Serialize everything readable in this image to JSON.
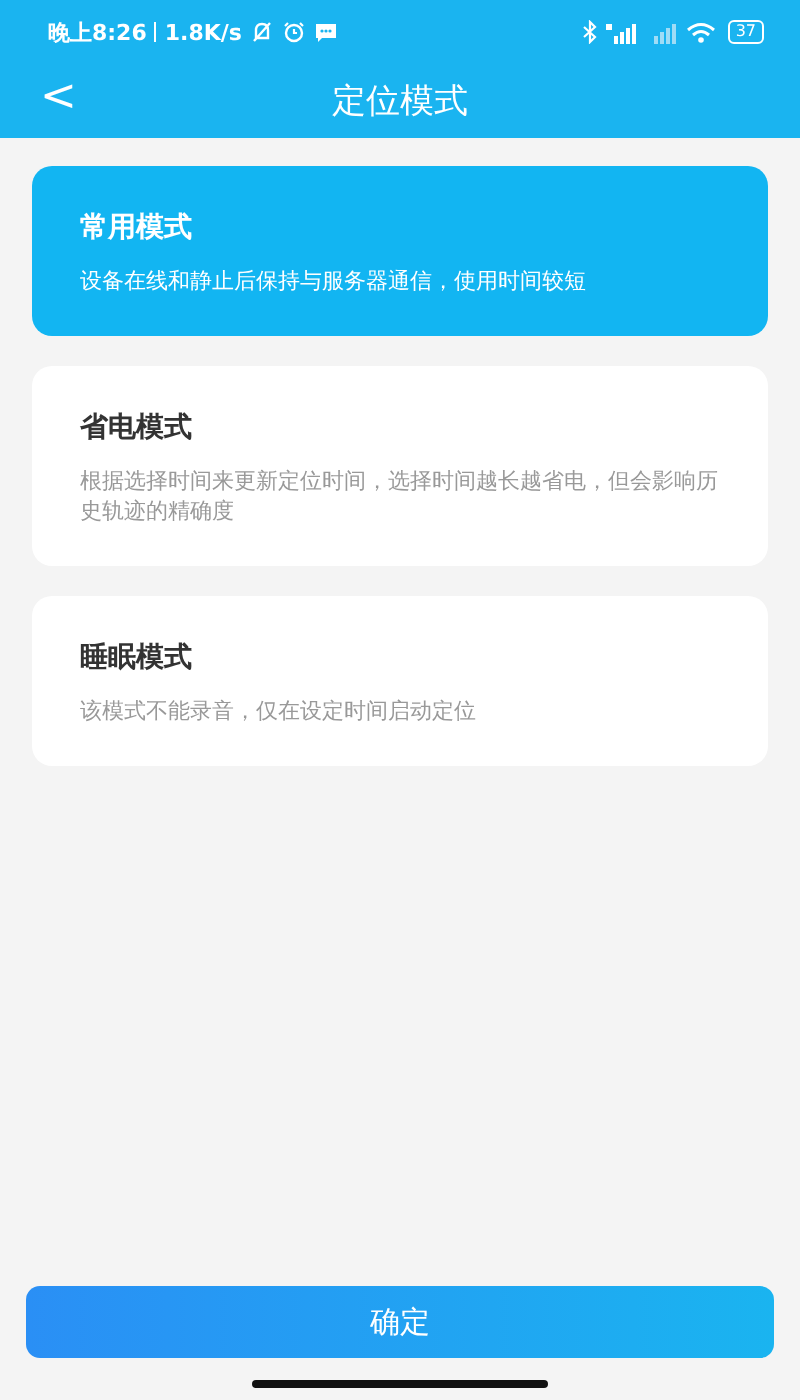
{
  "status_bar": {
    "time": "晚上8:26",
    "speed": "1.8K/s",
    "battery": "37"
  },
  "header": {
    "back": "<",
    "title": "定位模式"
  },
  "modes": [
    {
      "title": "常用模式",
      "description": "设备在线和静止后保持与服务器通信，使用时间较短",
      "selected": true
    },
    {
      "title": "省电模式",
      "description": "根据选择时间来更新定位时间，选择时间越长越省电，但会影响历史轨迹的精确度",
      "selected": false
    },
    {
      "title": "睡眠模式",
      "description": "该模式不能录音，仅在设定时间启动定位",
      "selected": false
    }
  ],
  "confirm_button": "确定"
}
